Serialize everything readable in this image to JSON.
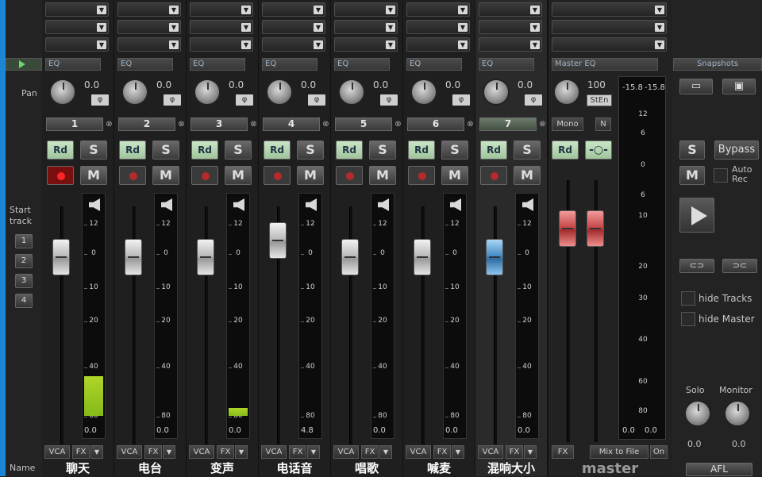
{
  "left": {
    "pan_label": "Pan",
    "start_track_label": "Start\ntrack",
    "start_buttons": [
      "1",
      "2",
      "3",
      "4"
    ],
    "name_label": "Name"
  },
  "channels": [
    {
      "num": "1",
      "name": "聊天",
      "pan": "0.0",
      "rec_on": true,
      "fader": "normal",
      "meter_val": "0.0",
      "level": 0.2
    },
    {
      "num": "2",
      "name": "电台",
      "pan": "0.0",
      "rec_on": false,
      "fader": "normal",
      "meter_val": "0.0",
      "level": 0.0
    },
    {
      "num": "3",
      "name": "变声",
      "pan": "0.0",
      "rec_on": false,
      "fader": "normal",
      "meter_val": "0.0",
      "level": 0.04
    },
    {
      "num": "4",
      "name": "电话音",
      "pan": "0.0",
      "rec_on": false,
      "fader": "normal",
      "meter_val": "4.8",
      "level": 0.0
    },
    {
      "num": "5",
      "name": "唱歌",
      "pan": "0.0",
      "rec_on": false,
      "fader": "normal",
      "meter_val": "0.0",
      "level": 0.0
    },
    {
      "num": "6",
      "name": "喊麦",
      "pan": "0.0",
      "rec_on": false,
      "fader": "normal",
      "meter_val": "0.0",
      "level": 0.0
    },
    {
      "num": "7",
      "name": "混响大小",
      "pan": "0.0",
      "rec_on": false,
      "fader": "blue",
      "meter_val": "0.0",
      "level": 0.0
    }
  ],
  "strip_labels": {
    "eq": "EQ",
    "rd": "Rd",
    "s": "S",
    "m": "M",
    "vca": "VCA",
    "fx": "FX",
    "phi": "φ"
  },
  "meter_scale": [
    "12",
    "0",
    "10",
    "20",
    "40",
    "80"
  ],
  "master": {
    "eq_label": "Master EQ",
    "knob_val": "100",
    "sten": "StEn",
    "mono": "Mono",
    "n": "N",
    "rd": "Rd",
    "fx": "FX",
    "mix_to_file": "Mix to File",
    "on": "On",
    "name": "master",
    "peak_l": "-15.8",
    "peak_r": "-15.8",
    "scale": [
      "12",
      "6",
      "0",
      "6",
      "10",
      "20",
      "30",
      "40",
      "60",
      "80"
    ],
    "val_l": "0.0",
    "val_r": "0.0"
  },
  "snapshots": {
    "title": "Snapshots",
    "s": "S",
    "m": "M",
    "bypass": "Bypass",
    "auto_rec": "Auto\nRec",
    "hide_tracks": "hide Tracks",
    "hide_master": "hide Master",
    "solo": "Solo",
    "monitor": "Monitor",
    "solo_val": "0.0",
    "monitor_val": "0.0",
    "afl": "AFL"
  }
}
